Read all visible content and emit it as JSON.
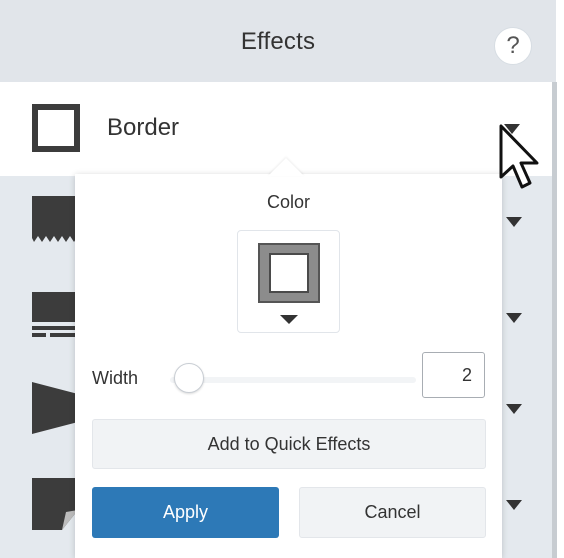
{
  "header": {
    "title": "Effects",
    "help_label": "?"
  },
  "effects": [
    {
      "label": "Border",
      "icon": "border-square-icon"
    },
    {
      "icon": "torn-edge-icon"
    },
    {
      "icon": "reflection-icon"
    },
    {
      "icon": "perspective-icon"
    },
    {
      "icon": "page-curl-icon"
    }
  ],
  "popover": {
    "color_label": "Color",
    "border_color": "#8c8c8c",
    "width_label": "Width",
    "width_value": "2",
    "quick_effects_label": "Add to Quick Effects",
    "apply_label": "Apply",
    "cancel_label": "Cancel"
  },
  "colors": {
    "accent": "#2d79b7"
  }
}
